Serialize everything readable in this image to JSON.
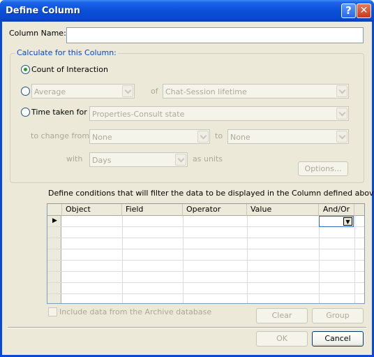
{
  "window": {
    "title": "Define Column",
    "help_label": "?",
    "close_label": "✕"
  },
  "column_name": {
    "label": "Column Name:",
    "value": ""
  },
  "calculate": {
    "group_title": "Calculate for this Column:",
    "count_label": "Count of Interaction",
    "count_selected": true,
    "aggregate_value": "Average",
    "of_label": "of",
    "of_value": "Chat-Session lifetime",
    "time_taken_label": "Time taken for",
    "time_taken_value": "Properties-Consult state",
    "change_from_label": "to change from",
    "change_from_value": "None",
    "to_label": "to",
    "to_value": "None",
    "with_label": "with",
    "units_value": "Days",
    "as_units_label": "as units",
    "options_button": "Options..."
  },
  "conditions": {
    "instruction": "Define conditions that will filter the data to be displayed in the Column defined above:",
    "columns": [
      "Object",
      "Field",
      "Operator",
      "Value",
      "And/Or"
    ],
    "current_row_marker": "▶",
    "rows": []
  },
  "archive": {
    "label": "Include data from the Archive database",
    "checked": false
  },
  "buttons": {
    "clear": "Clear",
    "group": "Group",
    "ok": "OK",
    "cancel": "Cancel"
  }
}
